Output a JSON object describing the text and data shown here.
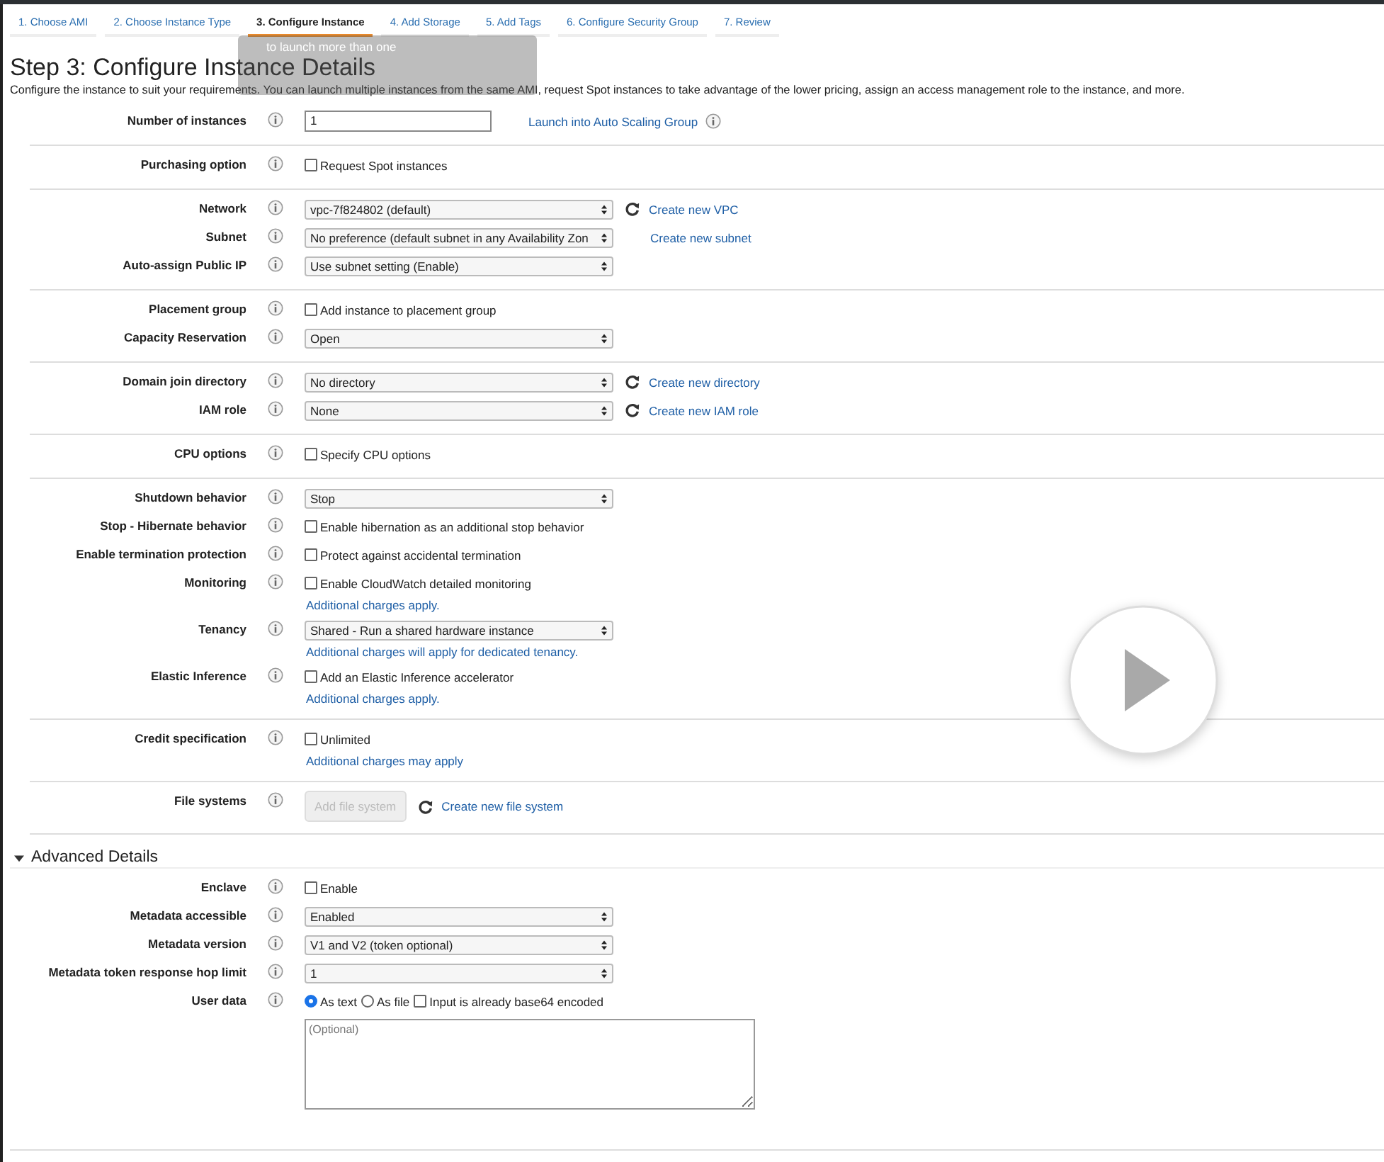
{
  "tabs": [
    {
      "label": "1. Choose AMI",
      "selected": false
    },
    {
      "label": "2. Choose Instance Type",
      "selected": false
    },
    {
      "label": "3. Configure Instance",
      "selected": true
    },
    {
      "label": "4. Add Storage",
      "selected": false
    },
    {
      "label": "5. Add Tags",
      "selected": false
    },
    {
      "label": "6. Configure Security Group",
      "selected": false
    },
    {
      "label": "7. Review",
      "selected": false
    }
  ],
  "title": "Step 3: Configure Instance Details",
  "description": "Configure the instance to suit your requirements. You can launch multiple instances from the same AMI, request Spot instances to take advantage of the lower pricing, assign an access management role to the instance, and more.",
  "tooltip": {
    "text": "to launch more than one"
  },
  "sections": [
    [
      {
        "label": "Number of instances",
        "kind": "text",
        "value": "1",
        "link": "Launch into Auto Scaling Group",
        "link_info": true
      }
    ],
    [
      {
        "label": "Purchasing option",
        "kind": "checkbox",
        "text": "Request Spot instances",
        "checked": false
      }
    ],
    [
      {
        "label": "Network",
        "kind": "select",
        "value": "vpc-7f824802 (default)",
        "refresh": true,
        "link": "Create new VPC"
      },
      {
        "label": "Subnet",
        "kind": "select",
        "value": "No preference (default subnet in any Availability Zon",
        "link": "Create new subnet"
      },
      {
        "label": "Auto-assign Public IP",
        "kind": "select",
        "value": "Use subnet setting (Enable)"
      }
    ],
    [
      {
        "label": "Placement group",
        "kind": "checkbox",
        "text": "Add instance to placement group",
        "checked": false
      },
      {
        "label": "Capacity Reservation",
        "kind": "select",
        "value": "Open"
      }
    ],
    [
      {
        "label": "Domain join directory",
        "kind": "select",
        "value": "No directory",
        "refresh": true,
        "link": "Create new directory"
      },
      {
        "label": "IAM role",
        "kind": "select",
        "value": "None",
        "refresh": true,
        "link": "Create new IAM role"
      }
    ],
    [
      {
        "label": "CPU options",
        "kind": "checkbox",
        "text": "Specify CPU options",
        "checked": false
      }
    ],
    [
      {
        "label": "Shutdown behavior",
        "kind": "select",
        "value": "Stop"
      },
      {
        "label": "Stop - Hibernate behavior",
        "kind": "checkbox",
        "text": "Enable hibernation as an additional stop behavior",
        "checked": false
      },
      {
        "label": "Enable termination protection",
        "kind": "checkbox",
        "text": "Protect against accidental termination",
        "checked": false
      },
      {
        "label": "Monitoring",
        "kind": "checkbox",
        "text": "Enable CloudWatch detailed monitoring",
        "checked": false,
        "note": "Additional charges apply."
      },
      {
        "label": "Tenancy",
        "kind": "select",
        "value": "Shared - Run a shared hardware instance",
        "note": "Additional charges will apply for dedicated tenancy."
      },
      {
        "label": "Elastic Inference",
        "kind": "checkbox",
        "text": "Add an Elastic Inference accelerator",
        "checked": false,
        "note": "Additional charges apply."
      }
    ],
    [
      {
        "label": "Credit specification",
        "kind": "checkbox",
        "text": "Unlimited",
        "checked": false,
        "note": "Additional charges may apply"
      }
    ],
    [
      {
        "label": "File systems",
        "kind": "button",
        "text": "Add file system",
        "disabled": true,
        "refresh": true,
        "link": "Create new file system"
      }
    ]
  ],
  "advanced": {
    "title": "Advanced Details",
    "expanded": true,
    "rows": [
      {
        "label": "Enclave",
        "kind": "checkbox",
        "text": "Enable",
        "checked": false
      },
      {
        "label": "Metadata accessible",
        "kind": "select",
        "value": "Enabled"
      },
      {
        "label": "Metadata version",
        "kind": "select",
        "value": "V1 and V2 (token optional)"
      },
      {
        "label": "Metadata token response hop limit",
        "kind": "select",
        "value": "1"
      },
      {
        "label": "User data",
        "kind": "userdata",
        "options": [
          {
            "label": "As text",
            "selected": true
          },
          {
            "label": "As file",
            "selected": false
          }
        ],
        "encoded": {
          "text": "Input is already base64 encoded",
          "checked": false
        },
        "placeholder": "(Optional)"
      }
    ]
  }
}
